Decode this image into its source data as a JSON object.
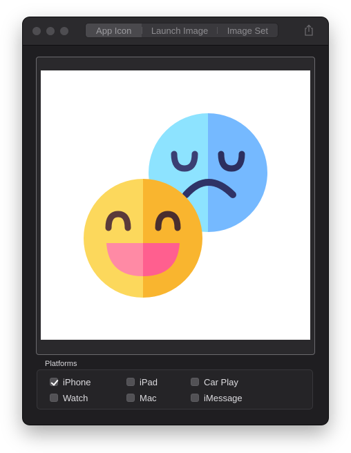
{
  "toolbar": {
    "tabs": [
      {
        "label": "App Icon",
        "selected": true
      },
      {
        "label": "Launch Image",
        "selected": false
      },
      {
        "label": "Image Set",
        "selected": false
      }
    ],
    "share_icon": "share-icon"
  },
  "preview": {
    "image_icon": "emoji-faces-icon",
    "colors": {
      "happy_left": "#fcd85c",
      "happy_right": "#f9b52f",
      "sad_left": "#8de3ff",
      "sad_right": "#75b9ff"
    }
  },
  "platforms": {
    "label": "Platforms",
    "options": [
      {
        "label": "iPhone",
        "checked": true
      },
      {
        "label": "iPad",
        "checked": false
      },
      {
        "label": "Car Play",
        "checked": false
      },
      {
        "label": "Watch",
        "checked": false
      },
      {
        "label": "Mac",
        "checked": false
      },
      {
        "label": "iMessage",
        "checked": false
      }
    ]
  }
}
